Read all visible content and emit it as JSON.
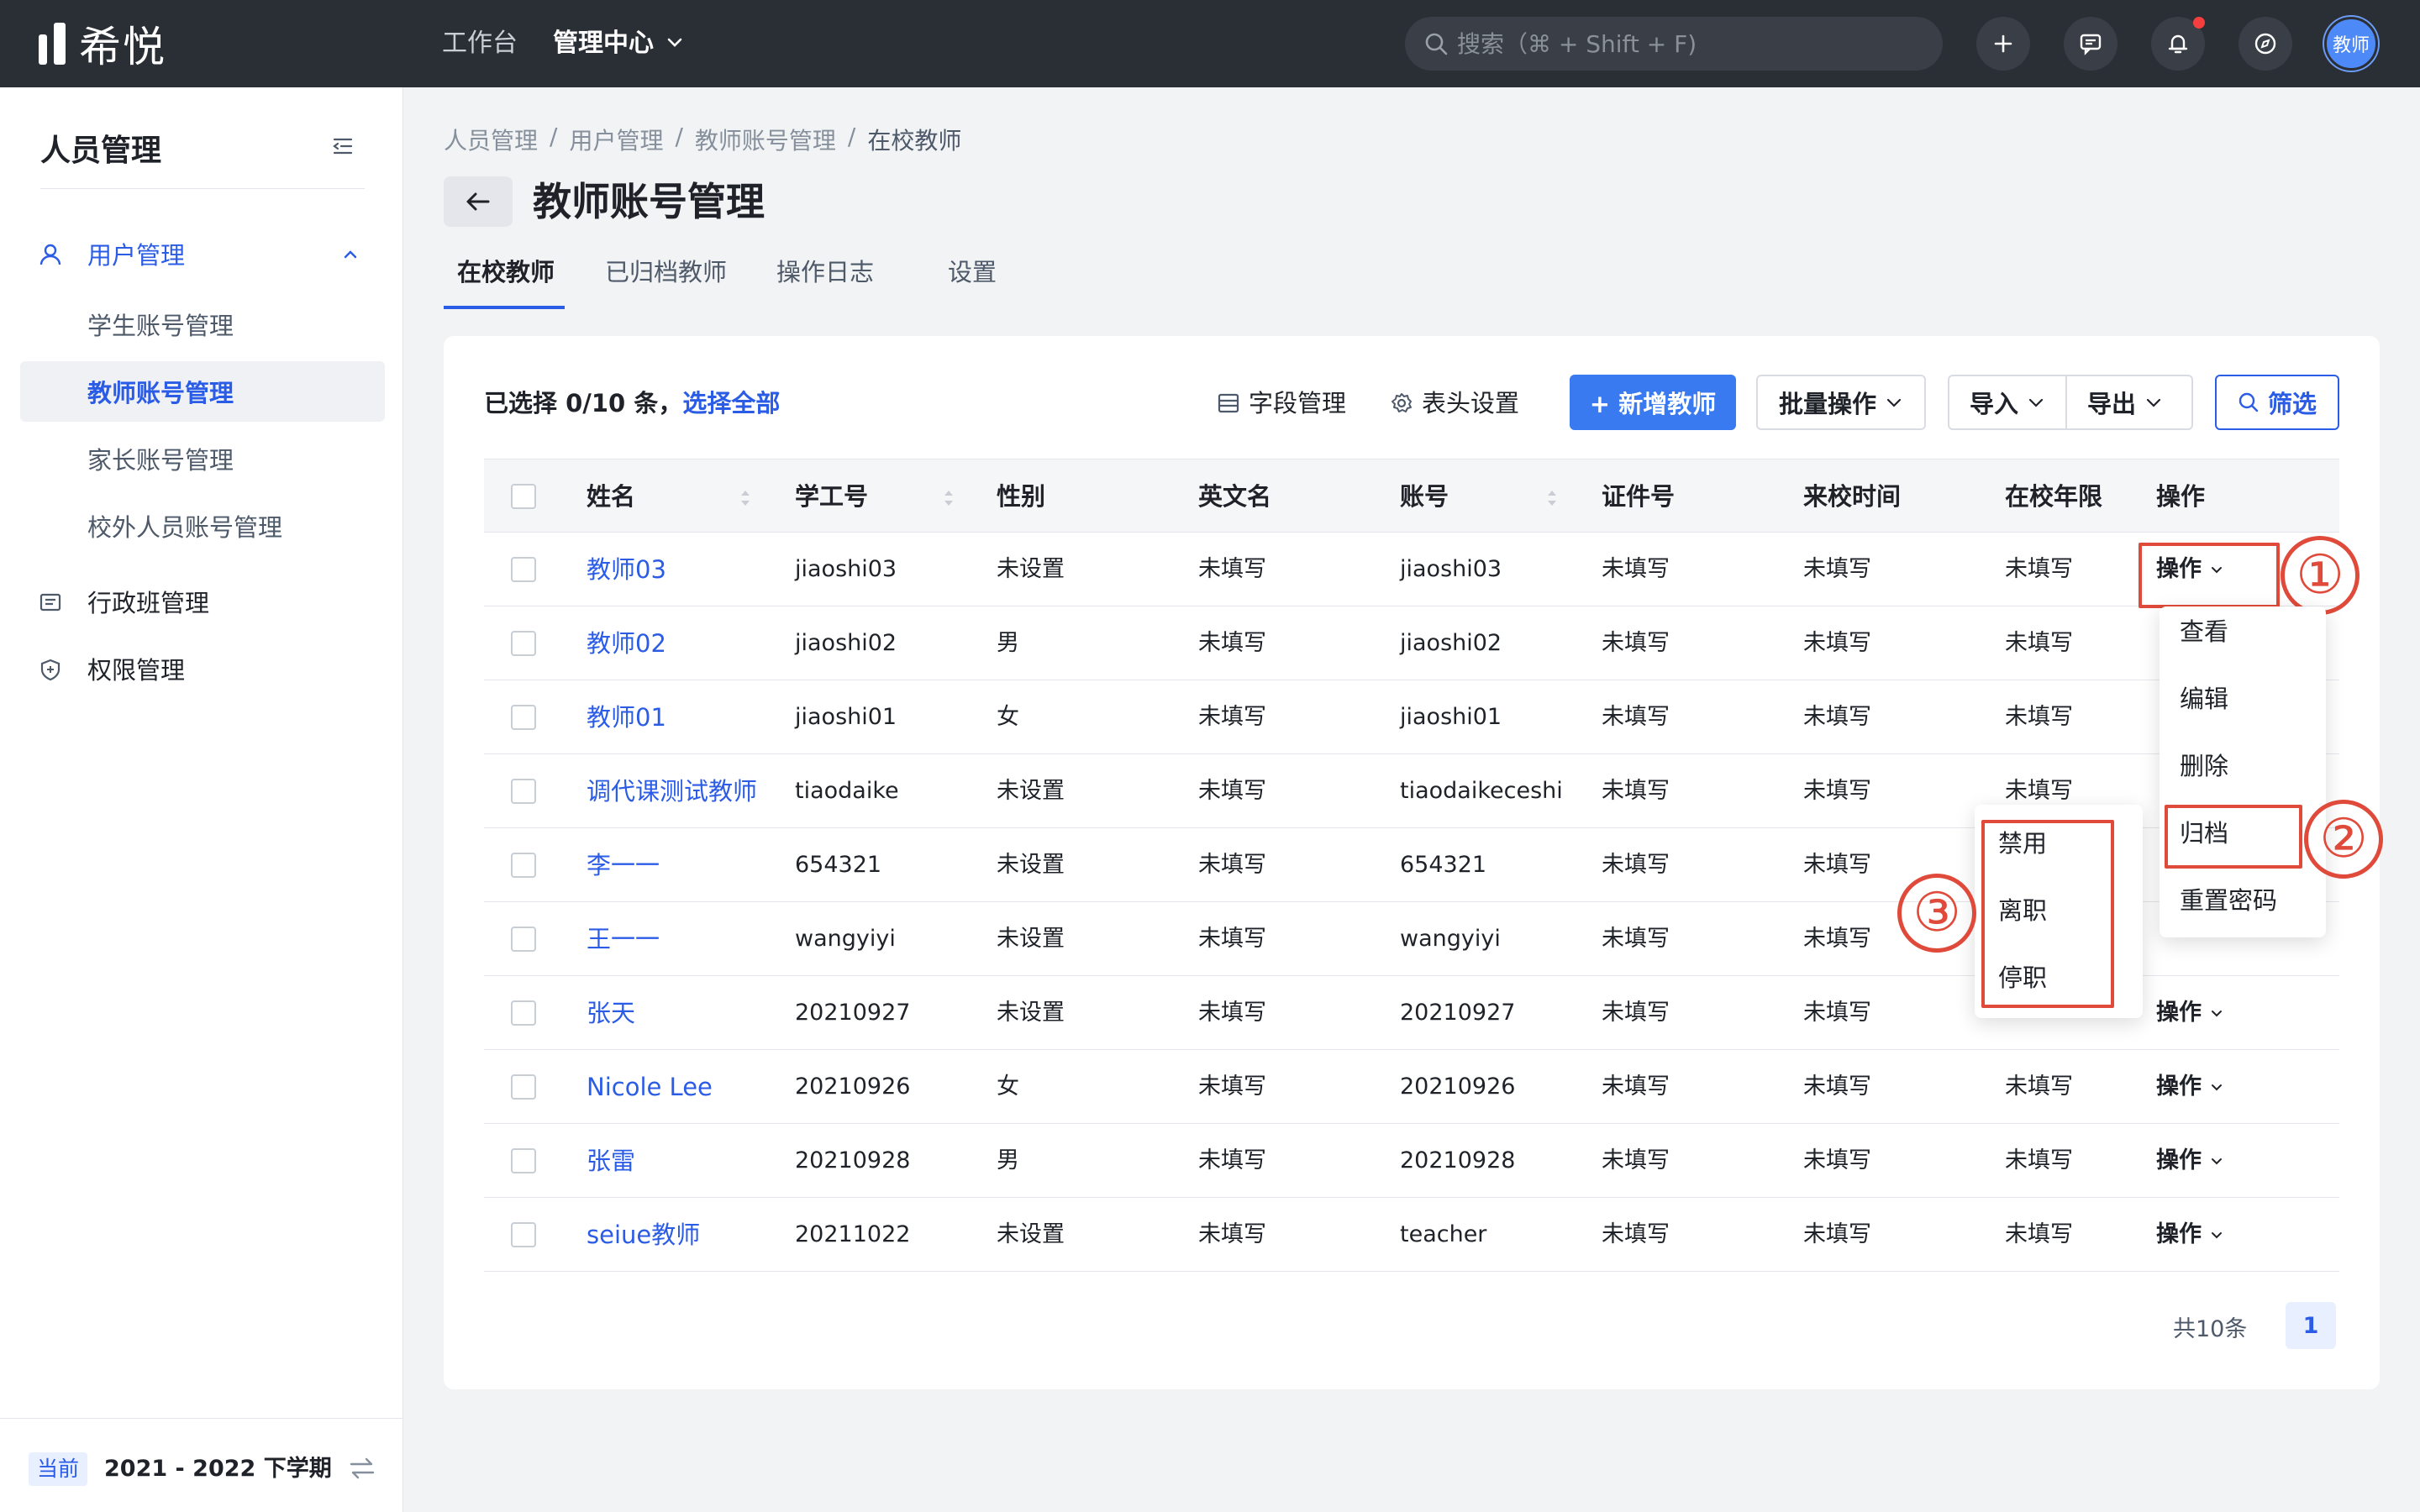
{
  "app": {
    "logo_text": "希悦"
  },
  "topnav": {
    "workbench": "工作台",
    "admin_center": "管理中心"
  },
  "search": {
    "placeholder": "搜索（⌘ + Shift + F)"
  },
  "user": {
    "avatar_text": "教师"
  },
  "sidebar": {
    "title": "人员管理",
    "groups": [
      {
        "label": "用户管理",
        "expanded": true,
        "icon": "user-icon"
      },
      {
        "label": "行政班管理",
        "icon": "class-list-icon"
      },
      {
        "label": "权限管理",
        "icon": "shield-icon"
      }
    ],
    "sub_items": [
      {
        "label": "学生账号管理"
      },
      {
        "label": "教师账号管理",
        "active": true
      },
      {
        "label": "家长账号管理"
      },
      {
        "label": "校外人员账号管理"
      }
    ],
    "footer": {
      "badge": "当前",
      "term": "2021 - 2022 下学期"
    }
  },
  "breadcrumb": [
    "人员管理",
    "用户管理",
    "教师账号管理",
    "在校教师"
  ],
  "page": {
    "title": "教师账号管理"
  },
  "tabs": [
    {
      "label": "在校教师",
      "active": true
    },
    {
      "label": "已归档教师"
    },
    {
      "label": "操作日志"
    },
    {
      "label": "设置"
    }
  ],
  "toolbar": {
    "selection_text": "已选择 0/10 条，",
    "select_all": "选择全部",
    "field_manage": "字段管理",
    "header_settings": "表头设置",
    "add_teacher": "+ 新增教师",
    "batch_ops": "批量操作",
    "import": "导入",
    "export": "导出",
    "filter": "筛选"
  },
  "table": {
    "columns": [
      "姓名",
      "学工号",
      "性别",
      "英文名",
      "账号",
      "证件号",
      "来校时间",
      "在校年限",
      "操作"
    ],
    "rows": [
      {
        "name": "教师03",
        "id": "jiaoshi03",
        "gender": "未设置",
        "en": "未填写",
        "account": "jiaoshi03",
        "cert": "未填写",
        "since": "未填写",
        "years": "未填写",
        "op": "操作"
      },
      {
        "name": "教师02",
        "id": "jiaoshi02",
        "gender": "男",
        "en": "未填写",
        "account": "jiaoshi02",
        "cert": "未填写",
        "since": "未填写",
        "years": "未填写",
        "op": ""
      },
      {
        "name": "教师01",
        "id": "jiaoshi01",
        "gender": "女",
        "en": "未填写",
        "account": "jiaoshi01",
        "cert": "未填写",
        "since": "未填写",
        "years": "未填写",
        "op": ""
      },
      {
        "name": "调代课测试教师",
        "id": "tiaodaike",
        "gender": "未设置",
        "en": "未填写",
        "account": "tiaodaikeceshi",
        "cert": "未填写",
        "since": "未填写",
        "years": "未填写",
        "op": ""
      },
      {
        "name": "李一一",
        "id": "654321",
        "gender": "未设置",
        "en": "未填写",
        "account": "654321",
        "cert": "未填写",
        "since": "未填写",
        "years": "",
        "op": ""
      },
      {
        "name": "王一一",
        "id": "wangyiyi",
        "gender": "未设置",
        "en": "未填写",
        "account": "wangyiyi",
        "cert": "未填写",
        "since": "未填写",
        "years": "",
        "op": ""
      },
      {
        "name": "张天",
        "id": "20210927",
        "gender": "未设置",
        "en": "未填写",
        "account": "20210927",
        "cert": "未填写",
        "since": "未填写",
        "years": "",
        "op": "操作"
      },
      {
        "name": "Nicole Lee",
        "id": "20210926",
        "gender": "女",
        "en": "未填写",
        "account": "20210926",
        "cert": "未填写",
        "since": "未填写",
        "years": "未填写",
        "op": "操作"
      },
      {
        "name": "张雷",
        "id": "20210928",
        "gender": "男",
        "en": "未填写",
        "account": "20210928",
        "cert": "未填写",
        "since": "未填写",
        "years": "未填写",
        "op": "操作"
      },
      {
        "name": "seiue教师",
        "id": "20211022",
        "gender": "未设置",
        "en": "未填写",
        "account": "teacher",
        "cert": "未填写",
        "since": "未填写",
        "years": "未填写",
        "op": "操作"
      }
    ]
  },
  "pagination": {
    "total": "共10条",
    "current": "1"
  },
  "op_menu": [
    "查看",
    "编辑",
    "删除",
    "归档",
    "重置密码"
  ],
  "archive_submenu": [
    "禁用",
    "离职",
    "停职"
  ],
  "annotations": [
    "①",
    "②",
    "③"
  ],
  "colors": {
    "accent": "#2b5ce6",
    "primary_button": "#3a7af0",
    "topbar": "#2a2e35",
    "annotation": "#e04a3a"
  }
}
